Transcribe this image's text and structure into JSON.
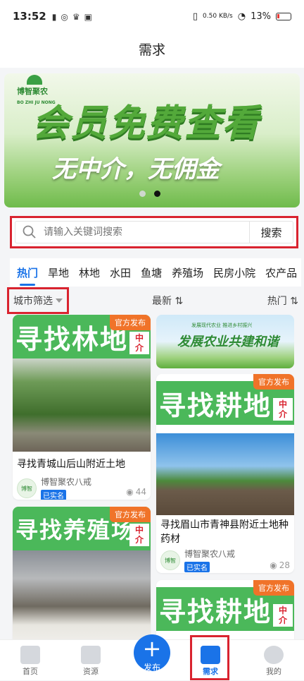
{
  "status_bar": {
    "time": "13:52",
    "net_speed": "0.50 KB/s",
    "battery": "13%"
  },
  "header": {
    "title": "需求"
  },
  "banner": {
    "logo": "博智聚农",
    "logo_sub": "BO ZHI JU NONG",
    "headline": "会员免费查看",
    "subline": "无中介，无佣金",
    "slide_count": 2,
    "active_slide": 2
  },
  "search": {
    "placeholder": "请输入关键词搜索",
    "button": "搜索"
  },
  "tabs": [
    "热门",
    "旱地",
    "林地",
    "水田",
    "鱼塘",
    "养殖场",
    "民房小院",
    "农产品"
  ],
  "filters": {
    "city": "城市筛选",
    "newest": "最新 ⇅",
    "hottest": "热门 ⇅"
  },
  "ad": {
    "small": "发展现代农业  推进乡村振兴",
    "big": "发展农业共建和谐"
  },
  "cards": [
    {
      "cover": "寻找林地",
      "badge": "官方发布",
      "tag": [
        "中",
        "介"
      ],
      "title": "寻找青城山后山附近土地",
      "user": "博智聚农八戒",
      "verified": "已实名",
      "views": "44"
    },
    {
      "cover": "寻找耕地",
      "badge": "官方发布",
      "tag": [
        "中",
        "介"
      ],
      "title": "寻找眉山市青神县附近土地种药材",
      "user": "博智聚农八戒",
      "verified": "已实名",
      "views": "28"
    },
    {
      "cover": "寻找养殖场",
      "badge": "官方发布",
      "tag": [
        "中",
        "介"
      ]
    },
    {
      "cover": "寻找耕地",
      "badge": "官方发布",
      "tag": [
        "中",
        "介"
      ]
    }
  ],
  "bottom_nav": [
    {
      "label": "首页",
      "icon": "home-icon"
    },
    {
      "label": "资源",
      "icon": "briefcase-icon"
    },
    {
      "label": "发布",
      "icon": "plus-icon"
    },
    {
      "label": "需求",
      "icon": "demand-icon"
    },
    {
      "label": "我的",
      "icon": "user-icon"
    }
  ]
}
